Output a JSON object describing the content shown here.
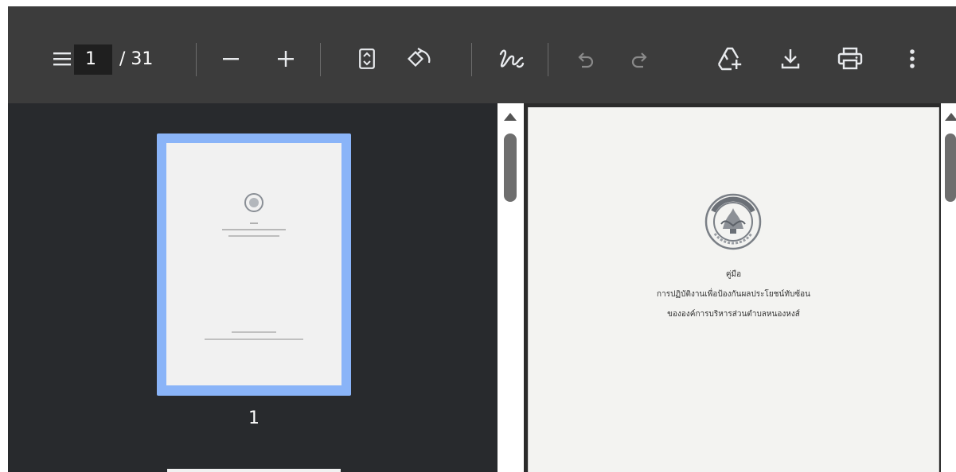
{
  "toolbar": {
    "current_page": "1",
    "total_pages": "/ 31",
    "icons": [
      "menu-icon",
      "zoom-out-icon",
      "zoom-in-icon",
      "fit-page-icon",
      "rotate-icon",
      "draw-icon",
      "undo-icon",
      "redo-icon",
      "add-to-drive-icon",
      "download-icon",
      "print-icon",
      "more-options-icon"
    ]
  },
  "sidebar": {
    "thumbnail_label": "1"
  },
  "document": {
    "title": "คู่มือ",
    "line2": "การปฏิบัติงานเพื่อป้องกันผลประโยชน์ทับซ้อน",
    "line3": "ขององค์การบริหารส่วนตำบลหนองหงส์"
  },
  "colors": {
    "toolbar_bg": "#3c3c3c",
    "sidebar_bg": "#282a2d",
    "thumb_highlight": "#8ab4f8",
    "page_bg": "#f3f3f1"
  }
}
